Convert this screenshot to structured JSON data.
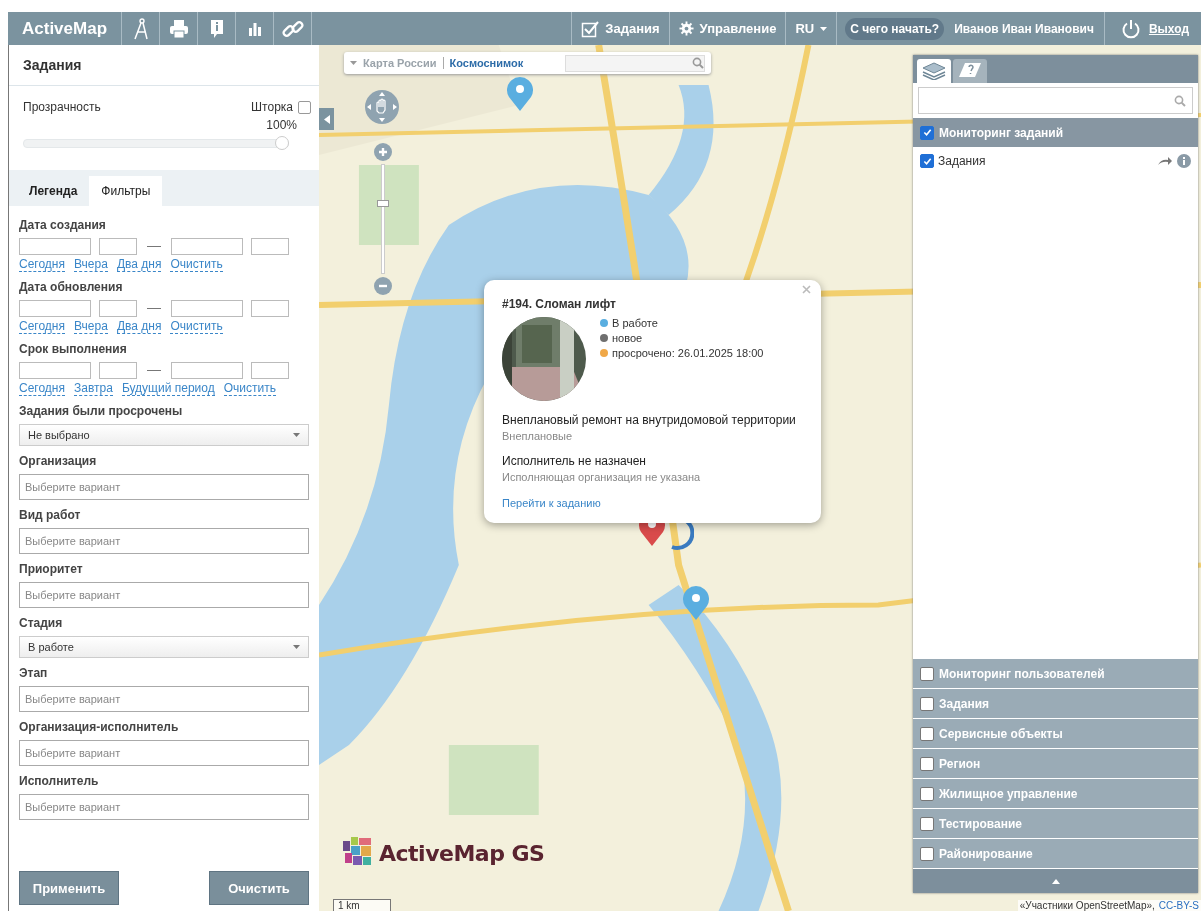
{
  "header": {
    "brand": "ActiveMap",
    "nav": [
      {
        "kind": "tasks",
        "label": "Задания"
      },
      {
        "kind": "settings",
        "label": "Управление"
      },
      {
        "kind": "lang",
        "label": "RU"
      }
    ],
    "help": "С чего начать?",
    "user": "Иванов Иван Иванович",
    "logout": "Выход"
  },
  "left_panel": {
    "title": "Задания",
    "transparency": {
      "label": "Прозрачность",
      "level": 1,
      "reading": "100%"
    },
    "shutter": {
      "label": "Шторка",
      "checked": false
    },
    "tabs": [
      {
        "label": "Легенда",
        "selected": false
      },
      {
        "label": "Фильтры",
        "selected": true
      }
    ],
    "filters": [
      {
        "kind": "date_range",
        "label": "Дата создания",
        "links": [
          "Сегодня",
          "Вчера",
          "Два дня",
          "Очистить"
        ]
      },
      {
        "kind": "date_range",
        "label": "Дата обновления",
        "links": [
          "Сегодня",
          "Вчера",
          "Два дня",
          "Очистить"
        ]
      },
      {
        "kind": "date_range",
        "label": "Срок выполнения",
        "links": [
          "Сегодня",
          "Завтра",
          "Будущий период",
          "Очистить"
        ]
      },
      {
        "kind": "select",
        "label": "Задания были просрочены",
        "value": "Не выбрано"
      },
      {
        "kind": "multi",
        "label": "Организация",
        "placeholder": "Выберите вариант"
      },
      {
        "kind": "multi",
        "label": "Вид работ",
        "placeholder": "Выберите вариант"
      },
      {
        "kind": "multi",
        "label": "Приоритет",
        "placeholder": "Выберите вариант"
      },
      {
        "kind": "select",
        "label": "Стадия",
        "value": "В работе"
      },
      {
        "kind": "multi",
        "label": "Этап",
        "placeholder": "Выберите вариант"
      },
      {
        "kind": "multi",
        "label": "Организация-исполнитель",
        "placeholder": "Выберите вариант"
      },
      {
        "kind": "multi",
        "label": "Исполнитель",
        "placeholder": "Выберите вариант"
      }
    ],
    "buttons": [
      "Применить",
      "Очистить"
    ]
  },
  "map": {
    "zoom": {
      "level": 0.65
    },
    "basemaps": [
      {
        "label": "Карта России",
        "selected": false
      },
      {
        "label": "Космоснимок",
        "selected": true
      }
    ],
    "popup": {
      "title": "#194. Сломан лифт",
      "statuses": [
        {
          "text": "В работе",
          "color": "#5aaee0"
        },
        {
          "text": "новое",
          "color": "#6f6f6f"
        },
        {
          "text": "просрочено: 26.01.2025 18:00",
          "color": "#f0a848"
        }
      ],
      "work": "Внеплановый ремонт на внутридомовой территории",
      "work_type": "Внеплановые",
      "executor": "Исполнитель не назначен",
      "organization": "Исполняющая организация не указана",
      "link": "Перейти к заданию"
    },
    "logo": "ActiveMap GS",
    "scale": "1 km",
    "attribution": "«Участники OpenStreetMap»,",
    "license": "CC-BY-S"
  },
  "layers_panel": {
    "tabs": [
      {
        "kind": "layers",
        "selected": true
      },
      {
        "kind": "help",
        "selected": false
      }
    ],
    "groups": [
      {
        "label": "Мониторинг заданий",
        "checked": true,
        "expanded": true,
        "children": [
          {
            "label": "Задания",
            "checked": true
          }
        ]
      },
      {
        "label": "Мониторинг пользователей",
        "checked": false,
        "expanded": false
      },
      {
        "label": "Задания",
        "checked": false,
        "expanded": false
      },
      {
        "label": "Сервисные объекты",
        "checked": false,
        "expanded": false
      },
      {
        "label": "Регион",
        "checked": false,
        "expanded": false
      },
      {
        "label": "Жилищное управление",
        "checked": false,
        "expanded": false
      },
      {
        "label": "Тестирование",
        "checked": false,
        "expanded": false
      },
      {
        "label": "Районирование",
        "checked": false,
        "expanded": false
      }
    ]
  }
}
